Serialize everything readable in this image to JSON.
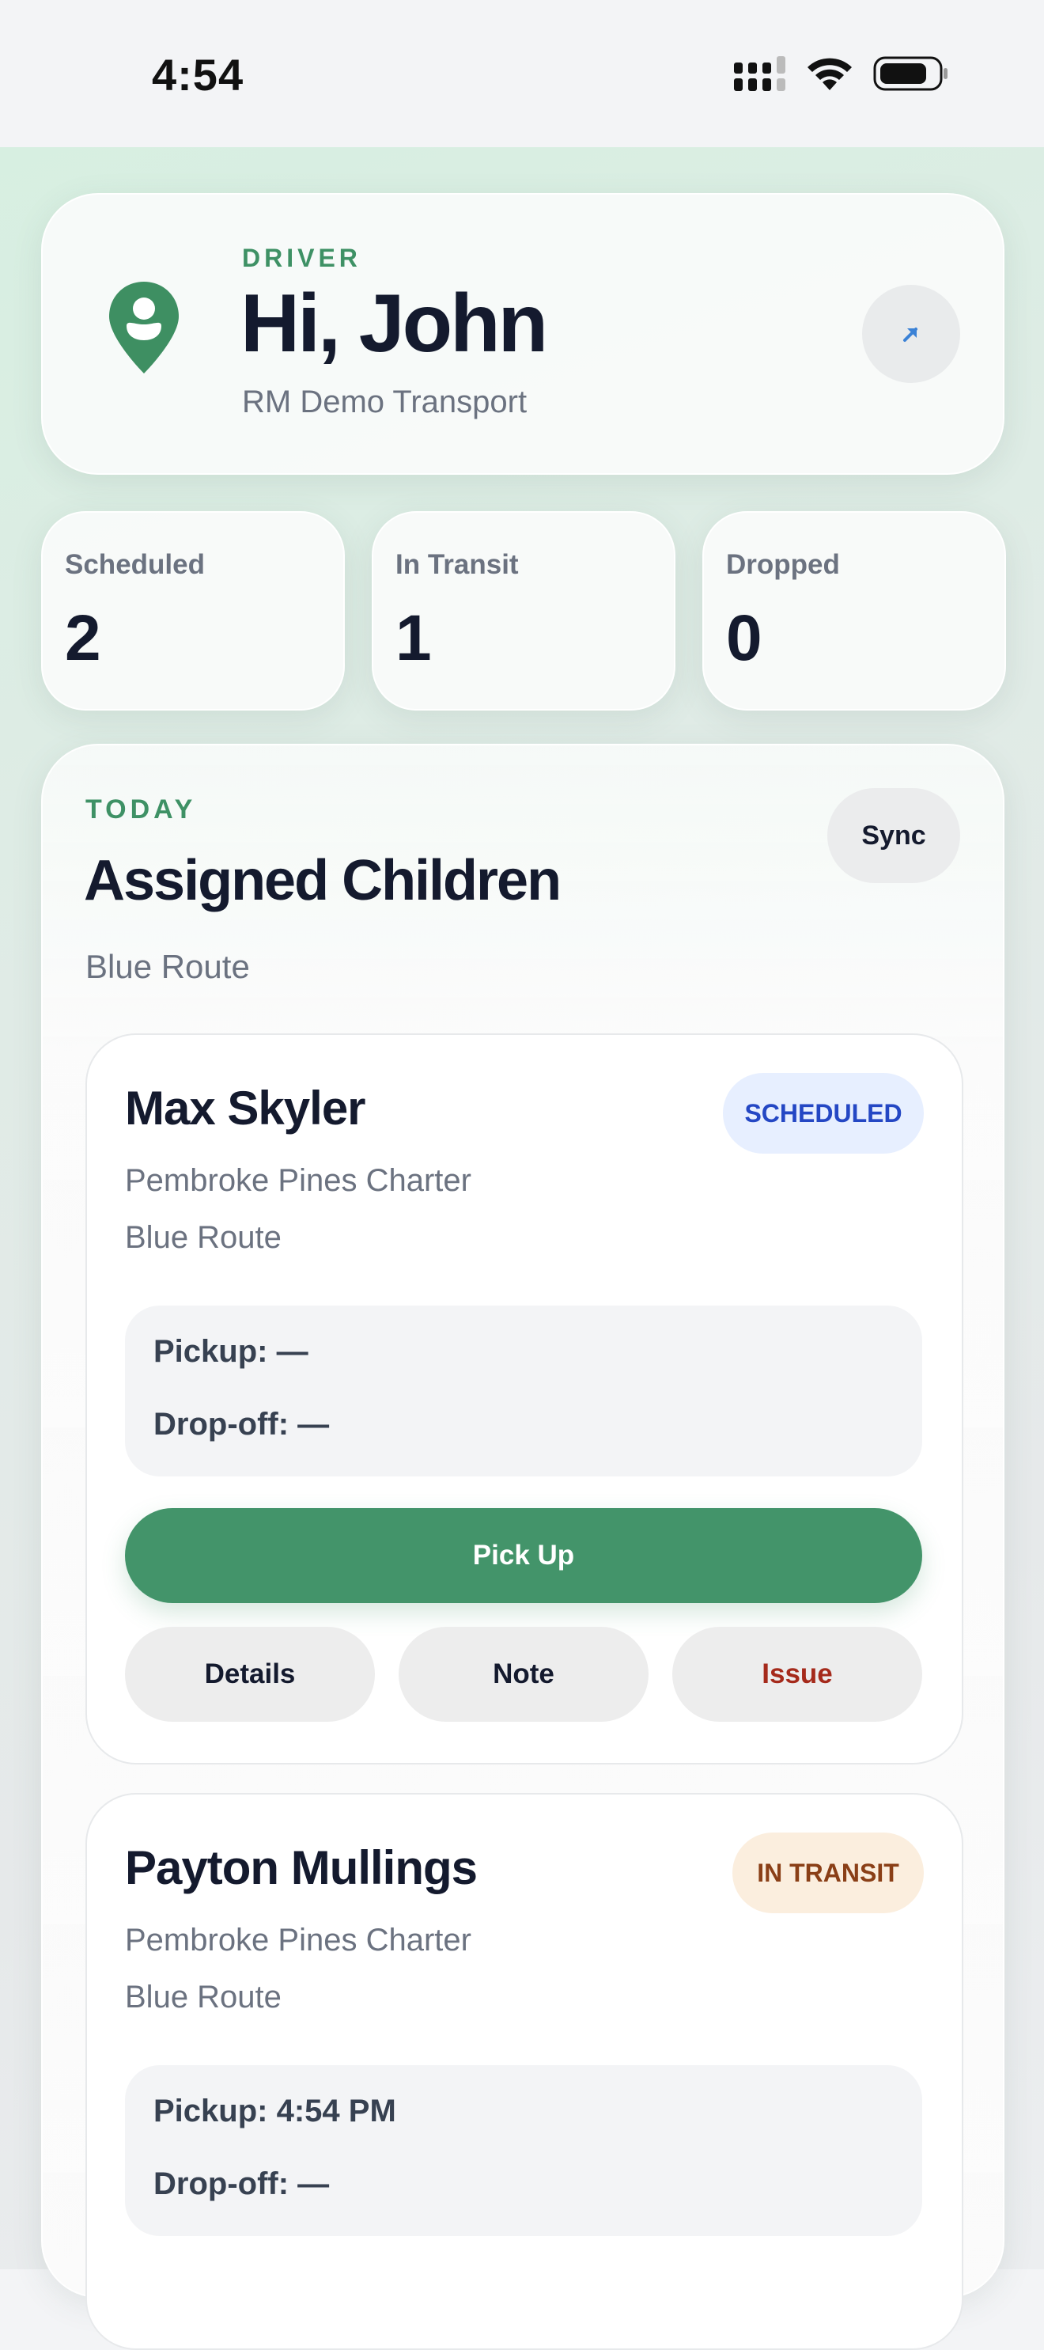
{
  "status_bar": {
    "time": "4:54"
  },
  "header": {
    "role": "DRIVER",
    "greeting": "Hi, John",
    "company": "RM Demo Transport",
    "share_icon": "arrow-up-right-icon",
    "location_icon": "map-pin-person-icon"
  },
  "stats": [
    {
      "label": "Scheduled",
      "value": "2"
    },
    {
      "label": "In Transit",
      "value": "1"
    },
    {
      "label": "Dropped",
      "value": "0"
    }
  ],
  "section": {
    "eyebrow": "TODAY",
    "title": "Assigned Children",
    "subtitle": "Blue Route",
    "sync_label": "Sync"
  },
  "children": [
    {
      "name": "Max Skyler",
      "status": "SCHEDULED",
      "school": "Pembroke Pines Charter",
      "route": "Blue Route",
      "pickup": "Pickup: —",
      "dropoff": "Drop-off: —",
      "primary_action": "Pick Up",
      "actions": [
        "Details",
        "Note",
        "Issue"
      ]
    },
    {
      "name": "Payton Mullings",
      "status": "IN TRANSIT",
      "school": "Pembroke Pines Charter",
      "route": "Blue Route",
      "pickup": "Pickup: 4:54 PM",
      "dropoff": "Drop-off: —"
    }
  ],
  "colors": {
    "accent": "#43946a",
    "scheduled_badge_bg": "#e7efff",
    "scheduled_badge_text": "#2447c4",
    "transit_badge_bg": "#fbeede",
    "transit_badge_text": "#8a3f17",
    "issue_text": "#a52a1b"
  }
}
